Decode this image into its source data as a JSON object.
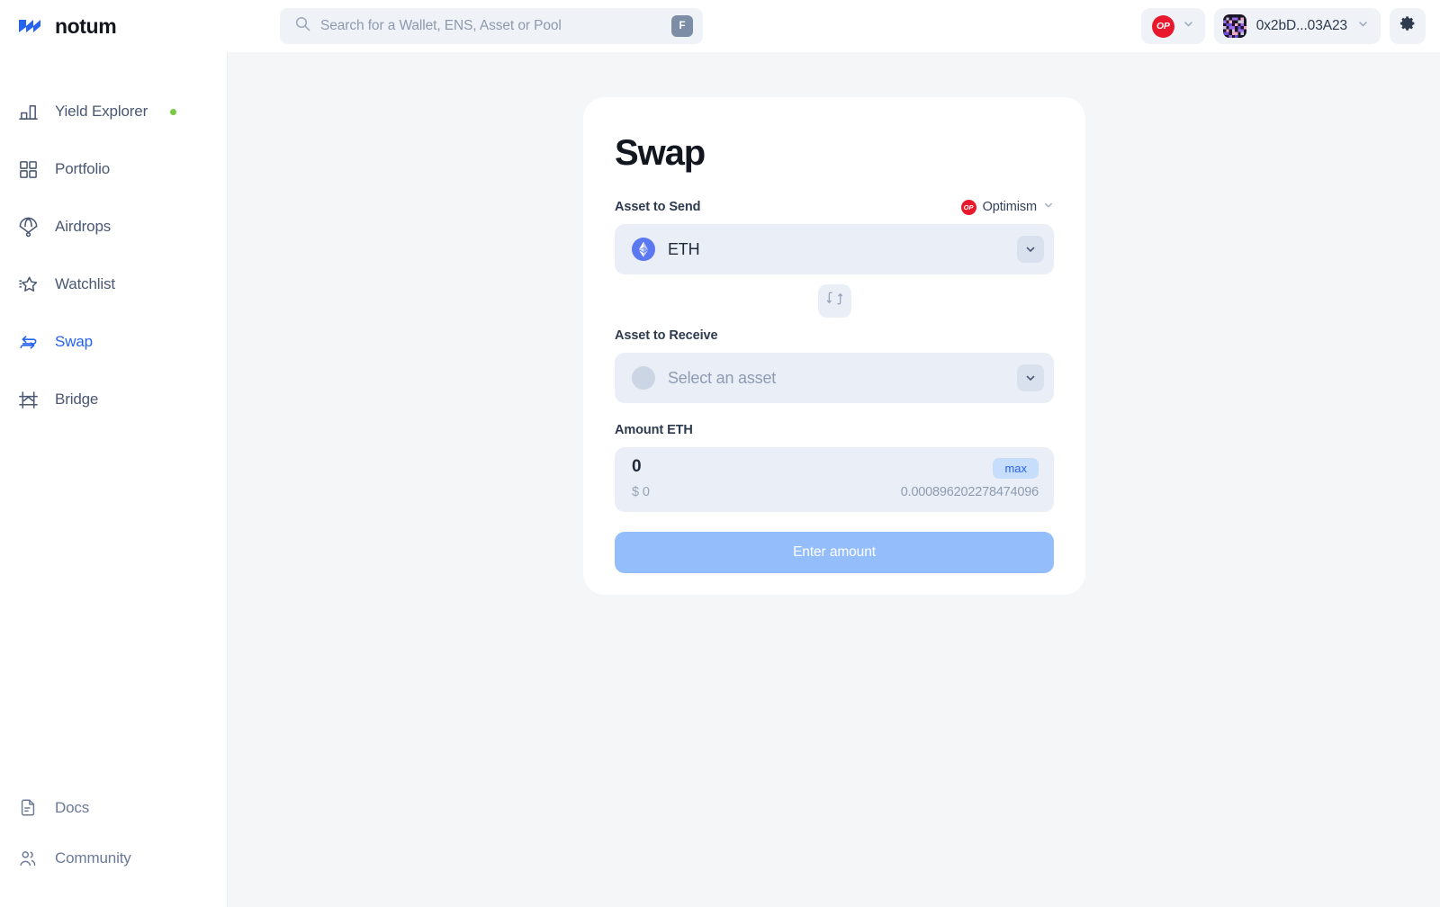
{
  "brand": {
    "name": "notum",
    "logo_icon": "notum-logo-icon"
  },
  "search": {
    "placeholder": "Search for a Wallet, ENS, Asset or Pool",
    "icon": "search-icon",
    "shortcut_key": "F"
  },
  "header": {
    "chain_badge": "OP",
    "chain_chevron_icon": "chevron-down-icon",
    "wallet_address": "0x2bD...03A23",
    "wallet_chevron_icon": "chevron-down-icon",
    "avatar_icon": "wallet-avatar",
    "settings_icon": "gear-icon"
  },
  "sidebar": {
    "items": [
      {
        "label": "Yield Explorer",
        "icon": "bar-chart-icon",
        "active": false,
        "dot": true
      },
      {
        "label": "Portfolio",
        "icon": "grid-squares-icon",
        "active": false,
        "dot": false
      },
      {
        "label": "Airdrops",
        "icon": "parachute-icon",
        "active": false,
        "dot": false
      },
      {
        "label": "Watchlist",
        "icon": "star-icon",
        "active": false,
        "dot": false
      },
      {
        "label": "Swap",
        "icon": "swap-arrows-icon",
        "active": true,
        "dot": false
      },
      {
        "label": "Bridge",
        "icon": "bridge-icon",
        "active": false,
        "dot": false
      }
    ],
    "bottom_items": [
      {
        "label": "Docs",
        "icon": "document-icon"
      },
      {
        "label": "Community",
        "icon": "users-icon"
      }
    ]
  },
  "swap_card": {
    "title": "Swap",
    "send": {
      "label": "Asset to Send",
      "chain_badge": "OP",
      "chain_name": "Optimism",
      "chain_chevron_icon": "chevron-down-icon",
      "token_symbol": "ETH",
      "token_icon": "eth-token-icon",
      "chevron_icon": "chevron-down-icon"
    },
    "swap_toggle_icon": "swap-vertical-icon",
    "receive": {
      "label": "Asset to Receive",
      "placeholder": "Select an asset",
      "token_icon": "placeholder-token-icon",
      "chevron_icon": "chevron-down-icon"
    },
    "amount": {
      "label": "Amount ETH",
      "value": "0",
      "usd_value": "$ 0",
      "max_label": "max",
      "balance": "0.000896202278474096"
    },
    "cta_label": "Enter amount"
  },
  "colors": {
    "accent_blue": "#2563f0",
    "cta_blue": "#94bdfb",
    "optimism_red": "#e8192c",
    "status_green": "#7ac943",
    "field_bg": "#eaeef6",
    "page_bg": "#f5f6f8"
  }
}
